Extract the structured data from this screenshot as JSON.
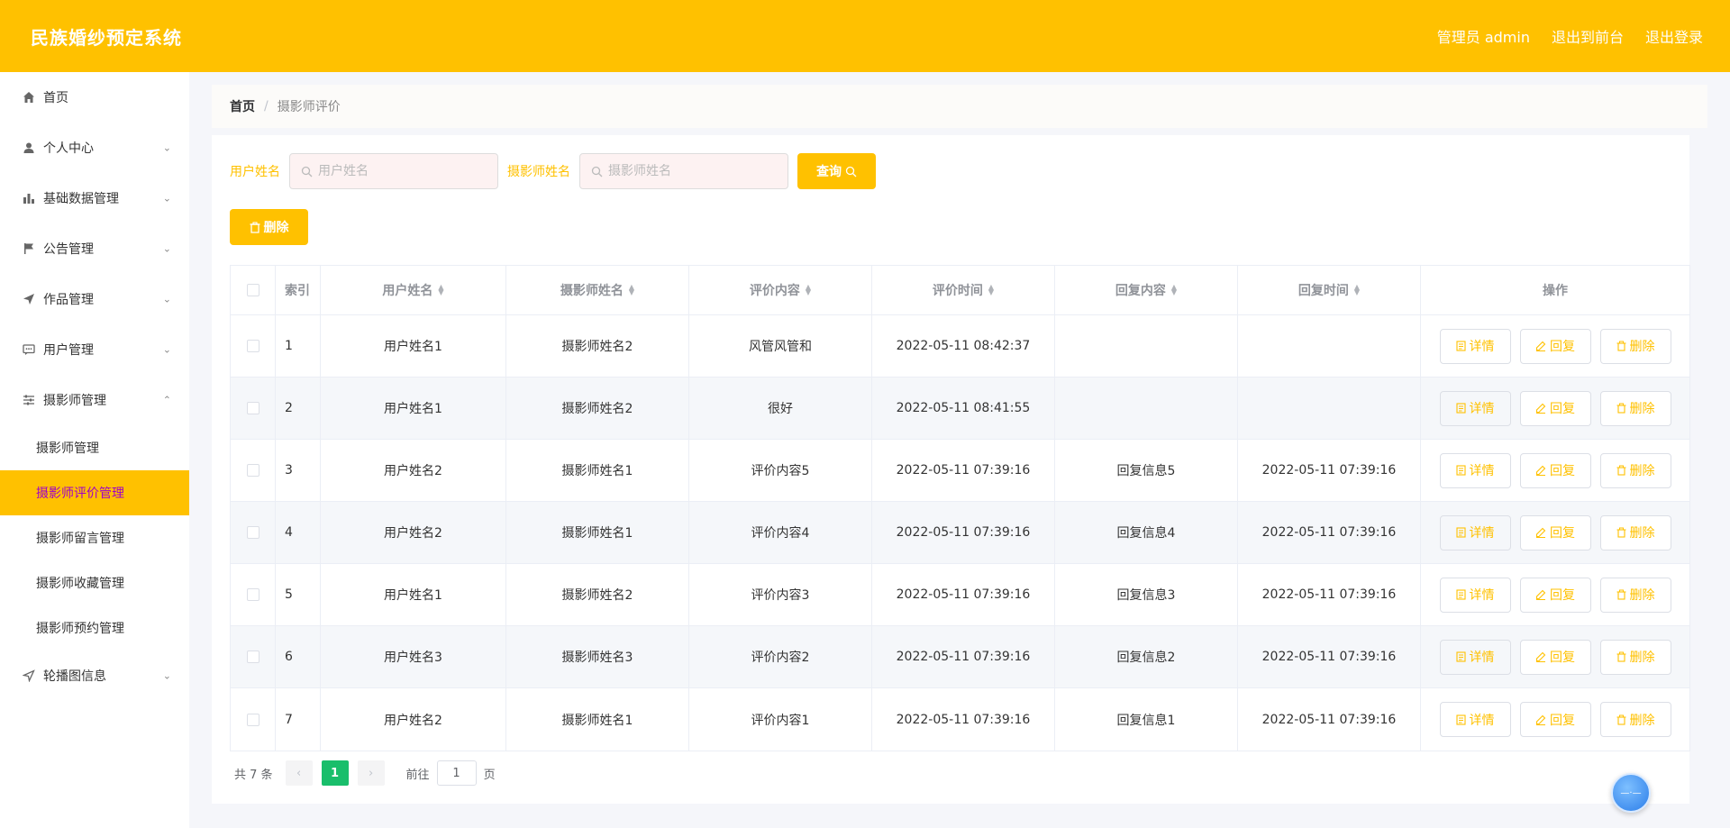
{
  "header": {
    "title": "民族婚纱预定系统",
    "admin_label": "管理员 admin",
    "to_front": "退出到前台",
    "logout": "退出登录"
  },
  "sidebar": {
    "items": [
      {
        "label": "首页",
        "icon": "home-icon"
      },
      {
        "label": "个人中心",
        "icon": "user-icon"
      },
      {
        "label": "基础数据管理",
        "icon": "bar-chart-icon"
      },
      {
        "label": "公告管理",
        "icon": "flag-icon"
      },
      {
        "label": "作品管理",
        "icon": "send-icon"
      },
      {
        "label": "用户管理",
        "icon": "chat-icon"
      },
      {
        "label": "摄影师管理",
        "icon": "sliders-icon"
      },
      {
        "label": "轮播图信息",
        "icon": "navigation-icon"
      }
    ],
    "sub": [
      "摄影师管理",
      "摄影师评价管理",
      "摄影师留言管理",
      "摄影师收藏管理",
      "摄影师预约管理"
    ],
    "active_sub": "摄影师评价管理"
  },
  "breadcrumb": {
    "home": "首页",
    "sep": "/",
    "current": "摄影师评价"
  },
  "search": {
    "user_label": "用户姓名",
    "user_placeholder": "用户姓名",
    "photo_label": "摄影师姓名",
    "photo_placeholder": "摄影师姓名",
    "query_button": "查询"
  },
  "toolbar": {
    "delete_button": "删除"
  },
  "table": {
    "headers": {
      "index": "索引",
      "user": "用户姓名",
      "photographer": "摄影师姓名",
      "content": "评价内容",
      "time": "评价时间",
      "reply": "回复内容",
      "reply_time": "回复时间",
      "ops": "操作"
    },
    "op_labels": {
      "detail": "详情",
      "reply": "回复",
      "delete": "删除"
    },
    "rows": [
      {
        "idx": "1",
        "user": "用户姓名1",
        "photographer": "摄影师姓名2",
        "content": "风管风管和",
        "time": "2022-05-11 08:42:37",
        "reply": "",
        "reply_time": ""
      },
      {
        "idx": "2",
        "user": "用户姓名1",
        "photographer": "摄影师姓名2",
        "content": "很好",
        "time": "2022-05-11 08:41:55",
        "reply": "",
        "reply_time": ""
      },
      {
        "idx": "3",
        "user": "用户姓名2",
        "photographer": "摄影师姓名1",
        "content": "评价内容5",
        "time": "2022-05-11 07:39:16",
        "reply": "回复信息5",
        "reply_time": "2022-05-11 07:39:16"
      },
      {
        "idx": "4",
        "user": "用户姓名2",
        "photographer": "摄影师姓名1",
        "content": "评价内容4",
        "time": "2022-05-11 07:39:16",
        "reply": "回复信息4",
        "reply_time": "2022-05-11 07:39:16"
      },
      {
        "idx": "5",
        "user": "用户姓名1",
        "photographer": "摄影师姓名2",
        "content": "评价内容3",
        "time": "2022-05-11 07:39:16",
        "reply": "回复信息3",
        "reply_time": "2022-05-11 07:39:16"
      },
      {
        "idx": "6",
        "user": "用户姓名3",
        "photographer": "摄影师姓名3",
        "content": "评价内容2",
        "time": "2022-05-11 07:39:16",
        "reply": "回复信息2",
        "reply_time": "2022-05-11 07:39:16"
      },
      {
        "idx": "7",
        "user": "用户姓名2",
        "photographer": "摄影师姓名1",
        "content": "评价内容1",
        "time": "2022-05-11 07:39:16",
        "reply": "回复信息1",
        "reply_time": "2022-05-11 07:39:16"
      }
    ]
  },
  "pagination": {
    "total": "共 7 条",
    "current": "1",
    "goto": "前往",
    "page_value": "1",
    "page_unit": "页"
  },
  "colors": {
    "accent": "#ffc100",
    "active_text": "#a000c8",
    "page_active": "#19be6b"
  }
}
